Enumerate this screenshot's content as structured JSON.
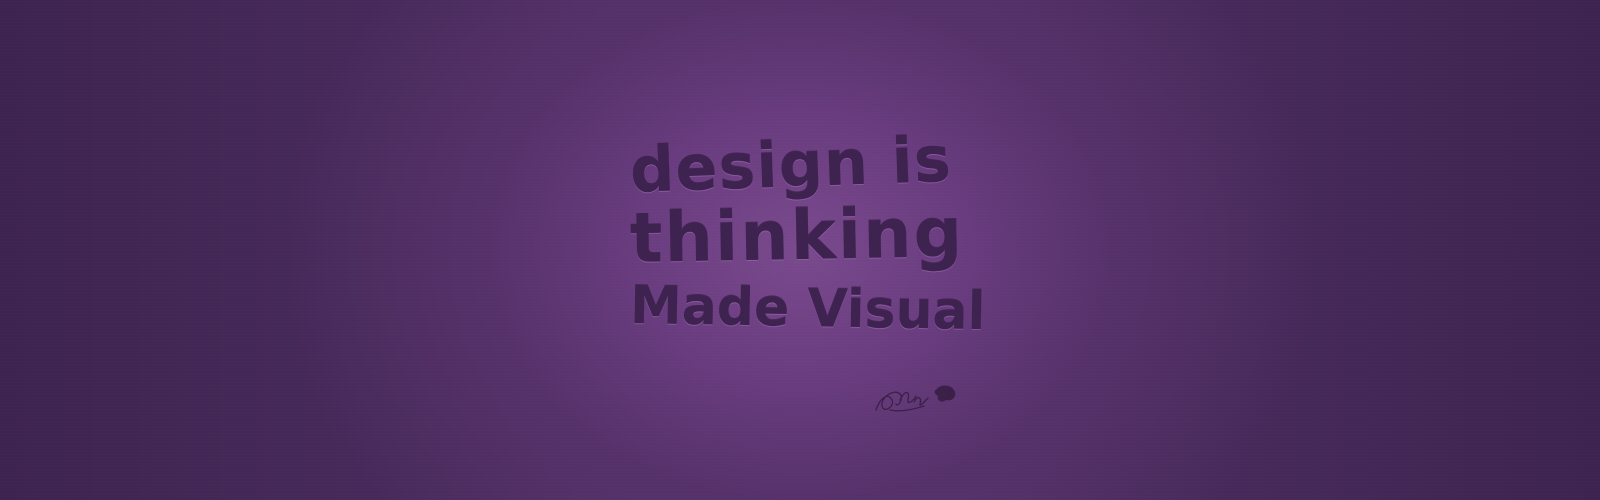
{
  "quote": {
    "line1": "design is",
    "line2": "thinking",
    "line3": "Made Visual"
  },
  "signature": {
    "text": "signature"
  },
  "colors": {
    "background_center": "#7a4a8e",
    "background_edge": "#3e2450",
    "text": "#3e2350"
  }
}
